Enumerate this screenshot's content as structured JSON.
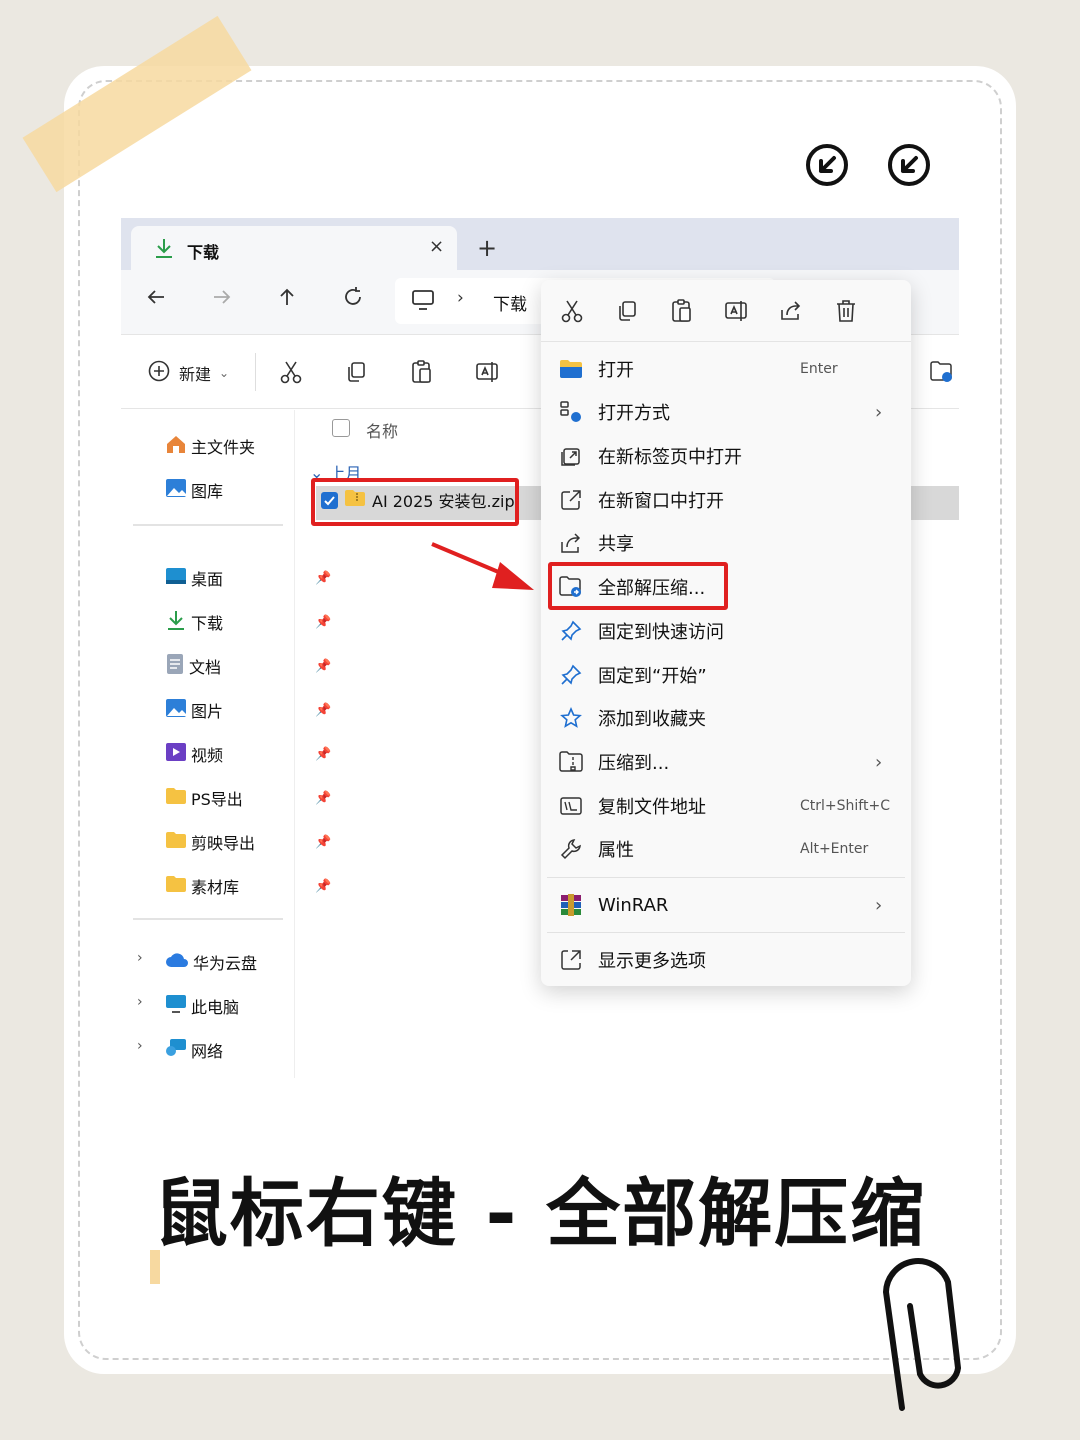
{
  "tab": {
    "title": "下载",
    "close": "×",
    "new": "+"
  },
  "nav": {
    "crumb": "下载",
    "chevron": "›"
  },
  "cmdbar": {
    "new_label": "新建",
    "new_chevron": "⌄"
  },
  "sidebar": {
    "top": [
      {
        "label": "主文件夹"
      },
      {
        "label": "图库"
      }
    ],
    "pinned": [
      {
        "label": "桌面"
      },
      {
        "label": "下载"
      },
      {
        "label": "文档"
      },
      {
        "label": "图片"
      },
      {
        "label": "视频"
      },
      {
        "label": "PS导出"
      },
      {
        "label": "剪映导出"
      },
      {
        "label": "素材库"
      }
    ],
    "bottom": [
      {
        "label": "华为云盘"
      },
      {
        "label": "此电脑"
      },
      {
        "label": "网络"
      }
    ],
    "expand": "›",
    "pin": "📌"
  },
  "content": {
    "column_name": "名称",
    "group": "上月",
    "group_chevron": "⌄",
    "file": "AI 2025 安装包.zip"
  },
  "menu": {
    "items": [
      {
        "label": "打开",
        "shortcut": "Enter",
        "chevron": ""
      },
      {
        "label": "打开方式",
        "shortcut": "",
        "chevron": "›"
      },
      {
        "label": "在新标签页中打开",
        "shortcut": "",
        "chevron": ""
      },
      {
        "label": "在新窗口中打开",
        "shortcut": "",
        "chevron": ""
      },
      {
        "label": "共享",
        "shortcut": "",
        "chevron": ""
      },
      {
        "label": "全部解压缩...",
        "shortcut": "",
        "chevron": ""
      },
      {
        "label": "固定到快速访问",
        "shortcut": "",
        "chevron": ""
      },
      {
        "label": "固定到“开始”",
        "shortcut": "",
        "chevron": ""
      },
      {
        "label": "添加到收藏夹",
        "shortcut": "",
        "chevron": ""
      },
      {
        "label": "压缩到...",
        "shortcut": "",
        "chevron": "›"
      },
      {
        "label": "复制文件地址",
        "shortcut": "Ctrl+Shift+C",
        "chevron": ""
      },
      {
        "label": "属性",
        "shortcut": "Alt+Enter",
        "chevron": ""
      },
      {
        "label": "WinRAR",
        "shortcut": "",
        "chevron": "›"
      },
      {
        "label": "显示更多选项",
        "shortcut": "",
        "chevron": ""
      }
    ]
  },
  "caption": "鼠标右键 - 全部解压缩",
  "colors": {
    "highlight": "#e02020",
    "accent": "#1f6fd0",
    "tape": "#f7d9a0"
  }
}
